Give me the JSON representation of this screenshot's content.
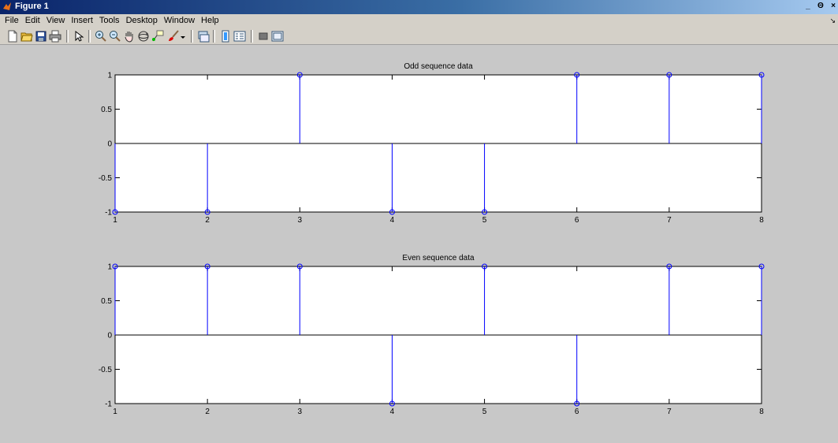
{
  "window": {
    "title": "Figure 1",
    "controls": [
      "_",
      "Θ",
      "×"
    ]
  },
  "menubar": {
    "items": [
      "File",
      "Edit",
      "View",
      "Insert",
      "Tools",
      "Desktop",
      "Window",
      "Help"
    ]
  },
  "toolbar": {
    "tools": [
      "new-figure-icon",
      "open-file-icon",
      "save-icon",
      "print-icon",
      "edit-plot-arrow-icon",
      "zoom-in-icon",
      "zoom-out-icon",
      "pan-hand-icon",
      "rotate-3d-icon",
      "data-cursor-icon",
      "brush-icon",
      "brush-dropdown-icon",
      "link-plot-icon",
      "colorbar-icon",
      "legend-icon",
      "hide-plot-tools-icon",
      "show-plot-tools-icon"
    ]
  },
  "colors": {
    "stem": "#0000ff",
    "axes_bg": "#ffffff",
    "figure_bg": "#c8c8c8"
  },
  "chart_data": [
    {
      "type": "scatter",
      "style": "stem",
      "title": "Odd sequence data",
      "x": [
        1,
        2,
        3,
        4,
        5,
        6,
        7,
        8
      ],
      "y": [
        -1,
        -1,
        1,
        -1,
        -1,
        1,
        1,
        1
      ],
      "xlim": [
        1,
        8
      ],
      "ylim": [
        -1,
        1
      ],
      "xticks": [
        "1",
        "2",
        "3",
        "4",
        "5",
        "6",
        "7",
        "8"
      ],
      "yticks": [
        "-1",
        "-0.5",
        "0",
        "0.5",
        "1"
      ],
      "xlabel": "",
      "ylabel": "",
      "grid": false
    },
    {
      "type": "scatter",
      "style": "stem",
      "title": "Even sequence data",
      "x": [
        1,
        2,
        3,
        4,
        5,
        6,
        7,
        8
      ],
      "y": [
        1,
        1,
        1,
        -1,
        1,
        -1,
        1,
        1
      ],
      "xlim": [
        1,
        8
      ],
      "ylim": [
        -1,
        1
      ],
      "xticks": [
        "1",
        "2",
        "3",
        "4",
        "5",
        "6",
        "7",
        "8"
      ],
      "yticks": [
        "-1",
        "-0.5",
        "0",
        "0.5",
        "1"
      ],
      "xlabel": "",
      "ylabel": "",
      "grid": false
    }
  ]
}
